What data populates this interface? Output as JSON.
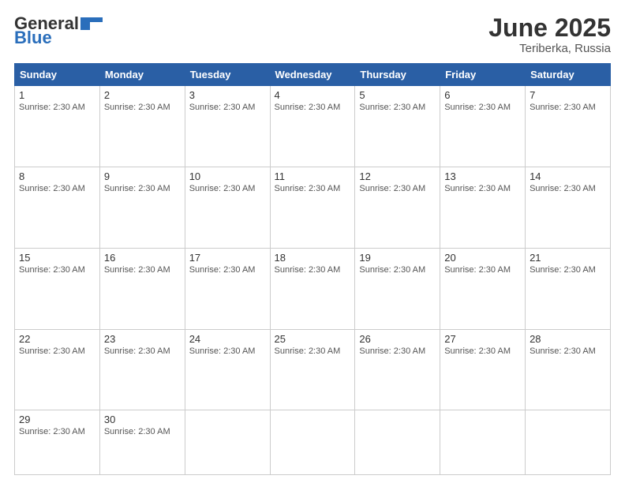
{
  "logo": {
    "line1": "General",
    "line2": "Blue"
  },
  "title": "June 2025",
  "subtitle": "Teriberka, Russia",
  "days_header": [
    "Sunday",
    "Monday",
    "Tuesday",
    "Wednesday",
    "Thursday",
    "Friday",
    "Saturday"
  ],
  "sunrise_text": "Sunrise: 2:30 AM",
  "weeks": [
    [
      {
        "day": "1",
        "sunrise": "Sunrise: 2:30 AM"
      },
      {
        "day": "2",
        "sunrise": "Sunrise: 2:30 AM"
      },
      {
        "day": "3",
        "sunrise": "Sunrise: 2:30 AM"
      },
      {
        "day": "4",
        "sunrise": "Sunrise: 2:30 AM"
      },
      {
        "day": "5",
        "sunrise": "Sunrise: 2:30 AM"
      },
      {
        "day": "6",
        "sunrise": "Sunrise: 2:30 AM"
      },
      {
        "day": "7",
        "sunrise": "Sunrise: 2:30 AM"
      }
    ],
    [
      {
        "day": "8",
        "sunrise": "Sunrise: 2:30 AM"
      },
      {
        "day": "9",
        "sunrise": "Sunrise: 2:30 AM"
      },
      {
        "day": "10",
        "sunrise": "Sunrise: 2:30 AM"
      },
      {
        "day": "11",
        "sunrise": "Sunrise: 2:30 AM"
      },
      {
        "day": "12",
        "sunrise": "Sunrise: 2:30 AM"
      },
      {
        "day": "13",
        "sunrise": "Sunrise: 2:30 AM"
      },
      {
        "day": "14",
        "sunrise": "Sunrise: 2:30 AM"
      }
    ],
    [
      {
        "day": "15",
        "sunrise": "Sunrise: 2:30 AM"
      },
      {
        "day": "16",
        "sunrise": "Sunrise: 2:30 AM"
      },
      {
        "day": "17",
        "sunrise": "Sunrise: 2:30 AM"
      },
      {
        "day": "18",
        "sunrise": "Sunrise: 2:30 AM"
      },
      {
        "day": "19",
        "sunrise": "Sunrise: 2:30 AM"
      },
      {
        "day": "20",
        "sunrise": "Sunrise: 2:30 AM"
      },
      {
        "day": "21",
        "sunrise": "Sunrise: 2:30 AM"
      }
    ],
    [
      {
        "day": "22",
        "sunrise": "Sunrise: 2:30 AM"
      },
      {
        "day": "23",
        "sunrise": "Sunrise: 2:30 AM"
      },
      {
        "day": "24",
        "sunrise": "Sunrise: 2:30 AM"
      },
      {
        "day": "25",
        "sunrise": "Sunrise: 2:30 AM"
      },
      {
        "day": "26",
        "sunrise": "Sunrise: 2:30 AM"
      },
      {
        "day": "27",
        "sunrise": "Sunrise: 2:30 AM"
      },
      {
        "day": "28",
        "sunrise": "Sunrise: 2:30 AM"
      }
    ],
    [
      {
        "day": "29",
        "sunrise": "Sunrise: 2:30 AM"
      },
      {
        "day": "30",
        "sunrise": "Sunrise: 2:30 AM"
      },
      {
        "day": "",
        "sunrise": ""
      },
      {
        "day": "",
        "sunrise": ""
      },
      {
        "day": "",
        "sunrise": ""
      },
      {
        "day": "",
        "sunrise": ""
      },
      {
        "day": "",
        "sunrise": ""
      }
    ]
  ]
}
